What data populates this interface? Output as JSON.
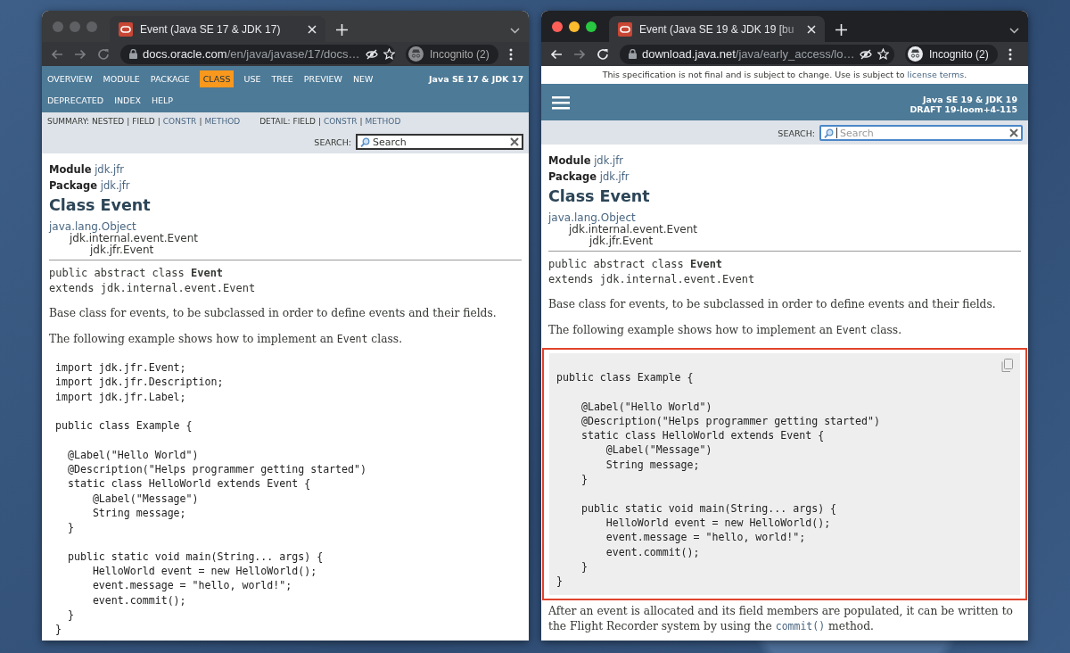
{
  "windows": [
    {
      "focused": false,
      "tab": {
        "title": "Event (Java SE 17 & JDK 17)",
        "title_faded": false
      },
      "back_enabled": false,
      "forward_enabled": false,
      "url": {
        "host": "docs.oracle.com",
        "path": "/en/java/javase/17/docs…"
      },
      "profile": "Incognito (2)",
      "page": {
        "navbar": {
          "collapsed": false,
          "items": [
            {
              "label": "OVERVIEW",
              "selected": false
            },
            {
              "label": "MODULE",
              "selected": false
            },
            {
              "label": "PACKAGE",
              "selected": false
            },
            {
              "label": "CLASS",
              "selected": true
            },
            {
              "label": "USE",
              "selected": false
            },
            {
              "label": "TREE",
              "selected": false
            },
            {
              "label": "PREVIEW",
              "selected": false
            },
            {
              "label": "NEW",
              "selected": false
            },
            {
              "label": "DEPRECATED",
              "selected": false
            },
            {
              "label": "INDEX",
              "selected": false
            },
            {
              "label": "HELP",
              "selected": false
            }
          ],
          "title_lines": [
            "Java SE 17 & JDK 17"
          ]
        },
        "subnav": [
          {
            "label": "SUMMARY:",
            "items": [
              {
                "text": "NESTED",
                "kind": "plain"
              },
              {
                "text": "|",
                "kind": "separator"
              },
              {
                "text": "FIELD",
                "kind": "plain"
              },
              {
                "text": "|",
                "kind": "separator"
              },
              {
                "text": "CONSTR",
                "kind": "link"
              },
              {
                "text": "|",
                "kind": "separator"
              },
              {
                "text": "METHOD",
                "kind": "link"
              }
            ]
          },
          {
            "label": "DETAIL:",
            "items": [
              {
                "text": "FIELD",
                "kind": "plain"
              },
              {
                "text": "|",
                "kind": "separator"
              },
              {
                "text": "CONSTR",
                "kind": "link"
              },
              {
                "text": "|",
                "kind": "separator"
              },
              {
                "text": "METHOD",
                "kind": "link"
              }
            ]
          }
        ],
        "search": {
          "label": "SEARCH:",
          "placeholder": "Search",
          "focused": false
        },
        "module": {
          "label": "Module",
          "value": "jdk.jfr"
        },
        "package": {
          "label": "Package",
          "value": "jdk.jfr"
        },
        "heading": "Class Event",
        "hierarchy": {
          "text": "java.lang.Object",
          "link": true,
          "children": [
            {
              "text": "jdk.internal.event.Event",
              "link": false,
              "children": [
                {
                  "text": "jdk.jfr.Event",
                  "link": false
                }
              ]
            }
          ]
        },
        "signature": [
          "public abstract class **Event**",
          "extends jdk.internal.event.Event"
        ],
        "blocks": [
          {
            "kind": "paragraph",
            "parts": [
              {
                "text": "Base class for events, to be subclassed in order to define events and their fields.",
                "kind": "text"
              }
            ]
          },
          {
            "kind": "paragraph",
            "parts": [
              {
                "text": "The following example shows how to implement an ",
                "kind": "text"
              },
              {
                "text": "Event",
                "kind": "code"
              },
              {
                "text": " class.",
                "kind": "text"
              }
            ]
          },
          {
            "kind": "code",
            "highlighted": false,
            "shaded": false,
            "copy_button": false,
            "code": "import jdk.jfr.Event;\nimport jdk.jfr.Description;\nimport jdk.jfr.Label;\n\npublic class Example {\n\n  @Label(\"Hello World\")\n  @Description(\"Helps programmer getting started\")\n  static class HelloWorld extends Event {\n      @Label(\"Message\")\n      String message;\n  }\n\n  public static void main(String... args) {\n      HelloWorld event = new HelloWorld();\n      event.message = \"hello, world!\";\n      event.commit();\n  }\n}"
          }
        ]
      }
    },
    {
      "focused": true,
      "tab": {
        "title": "Event (Java SE 19 & JDK 19 [bu",
        "title_faded": true
      },
      "back_enabled": true,
      "forward_enabled": false,
      "url": {
        "host": "download.java.net",
        "path": "/java/early_access/lo…"
      },
      "profile": "Incognito (2)",
      "page": {
        "notice": [
          {
            "text": "This specification is not final and is subject to change. Use is subject to ",
            "kind": "text"
          },
          {
            "text": "license terms",
            "kind": "link"
          },
          {
            "text": ".",
            "kind": "text"
          }
        ],
        "navbar": {
          "collapsed": true,
          "title_lines": [
            "Java SE 19 & JDK 19",
            "DRAFT 19-loom+4-115"
          ]
        },
        "search": {
          "label": "SEARCH:",
          "placeholder": "Search",
          "focused": true
        },
        "module": {
          "label": "Module",
          "value": "jdk.jfr"
        },
        "package": {
          "label": "Package",
          "value": "jdk.jfr"
        },
        "heading": "Class Event",
        "hierarchy": {
          "text": "java.lang.Object",
          "link": true,
          "children": [
            {
              "text": "jdk.internal.event.Event",
              "link": false,
              "children": [
                {
                  "text": "jdk.jfr.Event",
                  "link": false
                }
              ]
            }
          ]
        },
        "signature": [
          "public abstract class **Event**",
          "extends jdk.internal.event.Event"
        ],
        "blocks": [
          {
            "kind": "paragraph",
            "parts": [
              {
                "text": "Base class for events, to be subclassed in order to define events and their fields.",
                "kind": "text"
              }
            ]
          },
          {
            "kind": "paragraph",
            "parts": [
              {
                "text": "The following example shows how to implement an ",
                "kind": "text"
              },
              {
                "text": "Event",
                "kind": "code"
              },
              {
                "text": " class.",
                "kind": "text"
              }
            ]
          },
          {
            "kind": "code",
            "highlighted": true,
            "shaded": true,
            "copy_button": true,
            "code": "public class Example {\n\n    @Label(\"Hello World\")\n    @Description(\"Helps programmer getting started\")\n    static class HelloWorld extends Event {\n        @Label(\"Message\")\n        String message;\n    }\n\n    public static void main(String... args) {\n        HelloWorld event = new HelloWorld();\n        event.message = \"hello, world!\";\n        event.commit();\n    }\n}"
          },
          {
            "kind": "paragraph",
            "parts": [
              {
                "text": "After an event is allocated and its field members are populated, it can be written to the Flight Recorder system by using the ",
                "kind": "text"
              },
              {
                "text": "commit()",
                "kind": "code_link"
              },
              {
                "text": " method.",
                "kind": "text"
              }
            ]
          }
        ]
      }
    }
  ]
}
